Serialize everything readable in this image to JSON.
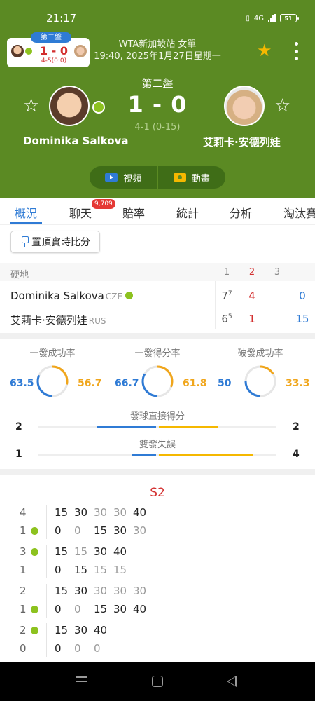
{
  "status_bar": {
    "time": "21:17",
    "network": "4G",
    "battery": "51"
  },
  "mini_card": {
    "set_label": "第二盤",
    "score": "1 - 0",
    "sub_score": "4-5(0:0)"
  },
  "match": {
    "tournament": "WTA新加坡站 女單",
    "datetime": "19:40, 2025年1月27日星期一",
    "set_label": "第二盤",
    "score": "1 - 0",
    "game_score": "4-1 (0-15)",
    "player1": "Dominika Salkova",
    "player2": "艾莉卡·安德列娃"
  },
  "media": {
    "video_label": "視頻",
    "animation_label": "動畫"
  },
  "tabs": [
    {
      "label": "概況",
      "active": true
    },
    {
      "label": "聊天",
      "badge": "9,709"
    },
    {
      "label": "賠率"
    },
    {
      "label": "統計"
    },
    {
      "label": "分析"
    },
    {
      "label": "淘汰賽"
    }
  ],
  "pin_button": {
    "label": "置頂實時比分"
  },
  "score_table": {
    "surface": "硬地",
    "set_headers": [
      "1",
      "2",
      "3"
    ],
    "rows": [
      {
        "name": "Dominika Salkova",
        "country": "CZE",
        "s1": "7",
        "s1_tb": "7",
        "s2": "4",
        "s3": "0"
      },
      {
        "name": "艾莉卡·安德列娃",
        "country": "RUS",
        "s1": "6",
        "s1_tb": "5",
        "s2": "1",
        "s3": "15"
      }
    ]
  },
  "serve_stats": [
    {
      "label": "一發成功率",
      "p1": "63.5",
      "p2": "56.7",
      "p1_value": 63.5,
      "p2_value": 56.7
    },
    {
      "label": "一發得分率",
      "p1": "66.7",
      "p2": "61.8",
      "p1_value": 66.7,
      "p2_value": 61.8
    },
    {
      "label": "破發成功率",
      "p1": "50",
      "p2": "33.3",
      "p1_value": 50,
      "p2_value": 33.3
    }
  ],
  "bar_stats": [
    {
      "label": "發球直接得分",
      "p1": "2",
      "p2": "2"
    },
    {
      "label": "雙發失誤",
      "p1": "1",
      "p2": "4"
    }
  ],
  "point_by_point": {
    "title": "S2",
    "games": [
      {
        "top": {
          "games": "4",
          "points": [
            "15",
            "30",
            "30",
            "30",
            "40"
          ]
        },
        "bottom": {
          "games": "1",
          "serve": true,
          "points": [
            "0",
            "0",
            "15",
            "30",
            "30"
          ]
        }
      },
      {
        "top": {
          "games": "3",
          "serve": true,
          "points": [
            "15",
            "15",
            "30",
            "40"
          ]
        },
        "bottom": {
          "games": "1",
          "points": [
            "0",
            "15",
            "15",
            "15"
          ]
        }
      },
      {
        "top": {
          "games": "2",
          "points": [
            "15",
            "30",
            "30",
            "30",
            "30"
          ]
        },
        "bottom": {
          "games": "1",
          "serve": true,
          "points": [
            "0",
            "0",
            "15",
            "30",
            "40"
          ]
        }
      },
      {
        "top": {
          "games": "2",
          "serve": true,
          "points": [
            "15",
            "30",
            "40"
          ]
        },
        "bottom": {
          "games": "0",
          "points": [
            "0",
            "0",
            "0"
          ]
        }
      }
    ]
  },
  "colors": {
    "header_green": "#5b8a23",
    "accent_blue": "#2f7bd5",
    "accent_yellow": "#f5b800",
    "score_red": "#d32f2f",
    "serve_green": "#8dc21f"
  }
}
